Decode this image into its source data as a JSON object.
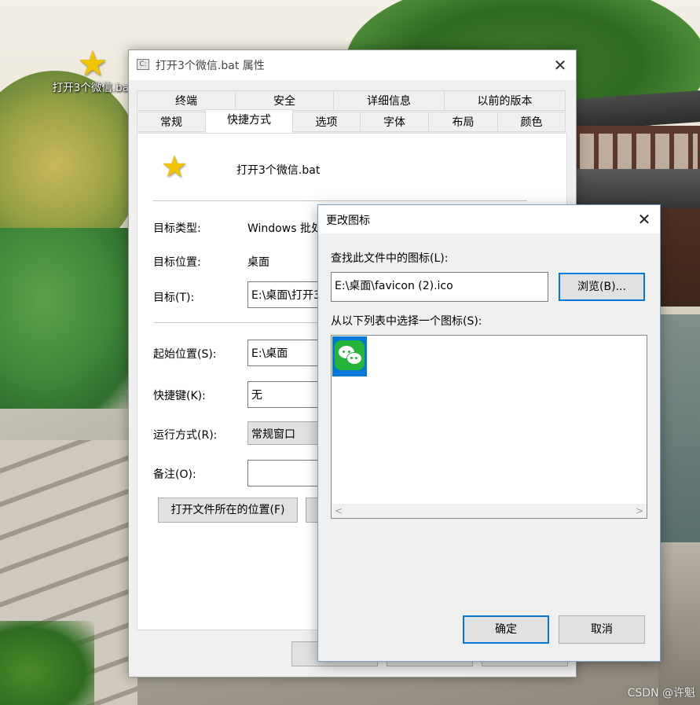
{
  "desktop": {
    "icon_label": "打开3个微信.bat",
    "watermark": "CSDN @许魁"
  },
  "props_window": {
    "title": "打开3个微信.bat 属性",
    "tabs_row1": [
      "终端",
      "安全",
      "详细信息",
      "以前的版本"
    ],
    "tabs_row2": [
      "常规",
      "快捷方式",
      "选项",
      "字体",
      "布局",
      "颜色"
    ],
    "active_tab": "快捷方式",
    "file_name": "打开3个微信.bat",
    "target_type_label": "目标类型:",
    "target_type_value": "Windows 批处",
    "target_location_label": "目标位置:",
    "target_location_value": "桌面",
    "target_label": "目标(T):",
    "target_value": "E:\\桌面\\打开3",
    "start_in_label": "起始位置(S):",
    "start_in_value": "E:\\桌面",
    "hotkey_label": "快捷键(K):",
    "hotkey_value": "无",
    "run_label": "运行方式(R):",
    "run_value": "常规窗口",
    "comment_label": "备注(O):",
    "comment_value": "",
    "open_location_button": "打开文件所在的位置(F)"
  },
  "change_icon_dialog": {
    "title": "更改图标",
    "find_label": "查找此文件中的图标(L):",
    "path_value": "E:\\桌面\\favicon (2).ico",
    "browse_button": "浏览(B)...",
    "list_label": "从以下列表中选择一个图标(S):",
    "icons": [
      "wechat-icon"
    ],
    "ok_button": "确定",
    "cancel_button": "取消"
  },
  "colors": {
    "accent": "#0078d7",
    "wechat_green": "#25b33a"
  }
}
